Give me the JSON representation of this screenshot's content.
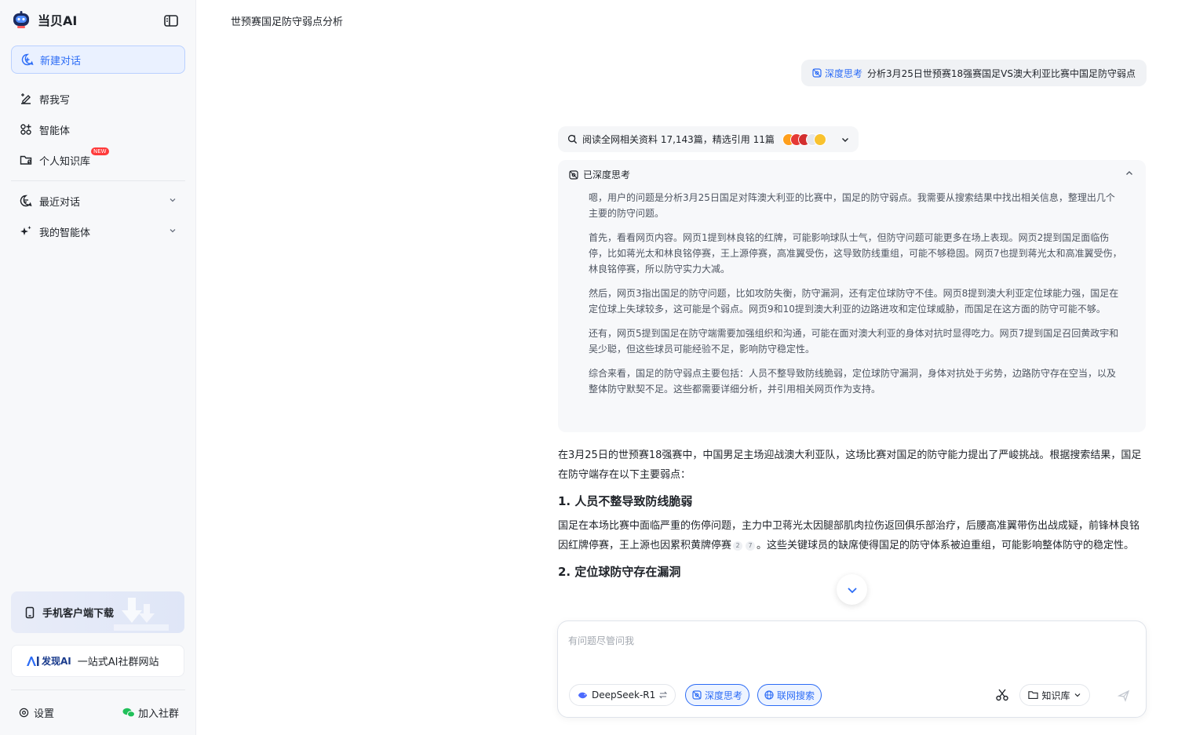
{
  "app": {
    "name": "当贝AI"
  },
  "sidebar": {
    "new_chat": "新建对话",
    "items": [
      {
        "label": "帮我写",
        "icon": "pen-icon"
      },
      {
        "label": "智能体",
        "icon": "apps-icon"
      },
      {
        "label": "个人知识库",
        "icon": "folder-icon",
        "badge": "NEW"
      }
    ],
    "sections": [
      {
        "label": "最近对话",
        "icon": "chat-bubble-icon"
      },
      {
        "label": "我的智能体",
        "icon": "sparkle-icon"
      }
    ],
    "download": "手机客户端下载",
    "promo": {
      "logo": "发现AI",
      "text": "一站式AI社群网站"
    },
    "settings": "设置",
    "community": "加入社群"
  },
  "conversation": {
    "title": "世预赛国足防守弱点分析",
    "user_message": {
      "tag": "深度思考",
      "text": "分析3月25日世预赛18强赛国足VS澳大利亚比赛中国足防守弱点"
    },
    "sources": {
      "text": "阅读全网相关资料 17,143篇，精选引用 11篇"
    },
    "thinking": {
      "label": "已深度思考",
      "paragraphs": [
        "嗯，用户的问题是分析3月25日国足对阵澳大利亚的比赛中，国足的防守弱点。我需要从搜索结果中找出相关信息，整理出几个主要的防守问题。",
        "首先，看看网页内容。网页1提到林良铭的红牌，可能影响球队士气，但防守问题可能更多在场上表现。网页2提到国足面临伤停，比如蒋光太和林良铭停赛，王上源停赛，高准翼受伤，这导致防线重组，可能不够稳固。网页7也提到蒋光太和高准翼受伤，林良铭停赛，所以防守实力大减。",
        "然后，网页3指出国足的防守问题，比如攻防失衡，防守漏洞，还有定位球防守不佳。网页8提到澳大利亚定位球能力强，国足在定位球上失球较多，这可能是个弱点。网页9和10提到澳大利亚的边路进攻和定位球威胁，而国足在这方面的防守可能不够。",
        "还有，网页5提到国足在防守端需要加强组织和沟通，可能在面对澳大利亚的身体对抗时显得吃力。网页7提到国足召回黄政宇和吴少聪，但这些球员可能经验不足，影响防守稳定性。",
        "综合来看，国足的防守弱点主要包括：人员不整导致防线脆弱，定位球防守漏洞，身体对抗处于劣势，边路防守存在空当，以及整体防守默契不足。这些都需要详细分析，并引用相关网页作为支持。"
      ]
    },
    "answer": {
      "intro": "在3月25日的世预赛18强赛中，中国男足主场迎战澳大利亚队，这场比赛对国足的防守能力提出了严峻挑战。根据搜索结果，国足在防守端存在以下主要弱点：",
      "section1_title": "1. 人员不整导致防线脆弱",
      "section1_text_a": "国足在本场比赛中面临严重的伤停问题，主力中卫蒋光太因腿部肌肉拉伤返回俱乐部治疗，后腰高准翼带伤出战成疑，前锋林良铭因红牌停赛，王上源也因累积黄牌停赛",
      "cite1": "2",
      "cite2": "7",
      "section1_text_b": "。这些关键球员的缺席使得国足的防守体系被迫重组，可能影响整体防守的稳定性。",
      "section2_title": "2. 定位球防守存在漏洞"
    }
  },
  "composer": {
    "placeholder": "有问题尽管问我",
    "model": "DeepSeek-R1",
    "deep_think": "深度思考",
    "web_search": "联网搜索",
    "knowledge_base": "知识库"
  },
  "colors": {
    "accent": "#2c6cf6",
    "sidebar_bg": "#f7f8fa"
  }
}
